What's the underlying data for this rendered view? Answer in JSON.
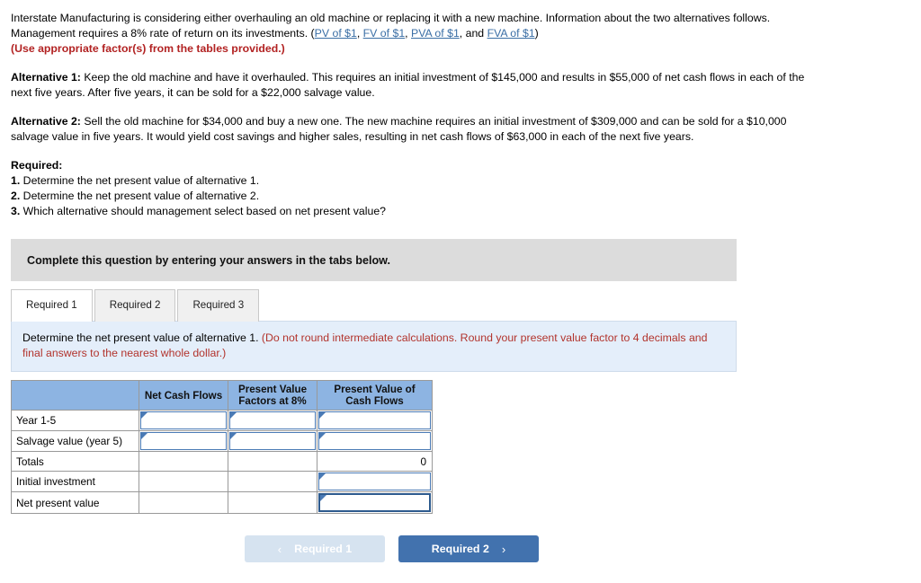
{
  "problem": {
    "intro_part1": "Interstate Manufacturing is considering either overhauling an old machine or replacing it with a new machine. Information about the two alternatives follows. Management requires a 8% rate of return on its investments. (",
    "links": [
      {
        "label": "PV of $1"
      },
      {
        "label": "FV of $1"
      },
      {
        "label": "PVA of $1"
      },
      {
        "label": "FVA of $1"
      }
    ],
    "link_sep": ", ",
    "link_and": ", and ",
    "intro_close": ")",
    "use_factors_note": "(Use appropriate factor(s) from the tables provided.)",
    "alt1_label": "Alternative 1:",
    "alt1_text": " Keep the old machine and have it overhauled. This requires an initial investment of $145,000 and results in $55,000 of net cash flows in each of the next five years. After five years, it can be sold for a $22,000 salvage value.",
    "alt2_label": "Alternative 2:",
    "alt2_text": " Sell the old machine for $34,000 and buy a new one. The new machine requires an initial investment of $309,000 and can be sold for a $10,000 salvage value in five years. It would yield cost savings and higher sales, resulting in net cash flows of $63,000 in each of the next five years.",
    "required_heading": "Required:",
    "required_items": [
      {
        "num": "1.",
        "text": " Determine the net present value of alternative 1."
      },
      {
        "num": "2.",
        "text": " Determine the net present value of alternative 2."
      },
      {
        "num": "3.",
        "text": " Which alternative should management select based on net present value?"
      }
    ]
  },
  "banner": {
    "text": "Complete this question by entering your answers in the tabs below."
  },
  "tabs": [
    {
      "label": "Required 1",
      "active": true
    },
    {
      "label": "Required 2",
      "active": false
    },
    {
      "label": "Required 3",
      "active": false
    }
  ],
  "instruction": {
    "main": "Determine the net present value of alternative 1. ",
    "note": "(Do not round intermediate calculations. Round your present value factor to 4 decimals and final answers to the nearest whole dollar.)"
  },
  "answer_table": {
    "headers": {
      "label": "",
      "net_cash_flows": "Net Cash Flows",
      "pv_factors": "Present Value Factors at 8%",
      "pv_cash_flows": "Present Value of Cash Flows"
    },
    "rows": [
      {
        "label": "Year 1-5",
        "net_cash_flows": "",
        "pv_factors": "",
        "pv_cash_flows": "",
        "type": "input"
      },
      {
        "label": "Salvage value (year 5)",
        "net_cash_flows": "",
        "pv_factors": "",
        "pv_cash_flows": "",
        "type": "input"
      },
      {
        "label": "Totals",
        "net_cash_flows": "",
        "pv_factors": "",
        "pv_cash_flows": "0",
        "type": "total"
      },
      {
        "label": "Initial investment",
        "net_cash_flows": "",
        "pv_factors": "",
        "pv_cash_flows": "",
        "type": "input-last"
      },
      {
        "label": "Net present value",
        "net_cash_flows": "",
        "pv_factors": "",
        "pv_cash_flows": "",
        "type": "input-heavy"
      }
    ]
  },
  "nav": {
    "prev_label": "Required 1",
    "prev_chevron": "‹",
    "next_label": "Required 2",
    "next_chevron": "›"
  },
  "colors": {
    "header_blue": "#8db4e2",
    "button_blue": "#4272ae",
    "button_disabled": "#d6e3f0",
    "banner_gray": "#dcdcdc",
    "instruction_blue": "#e4eefa",
    "link_blue": "#3a6ea5",
    "red": "#b2332c"
  }
}
